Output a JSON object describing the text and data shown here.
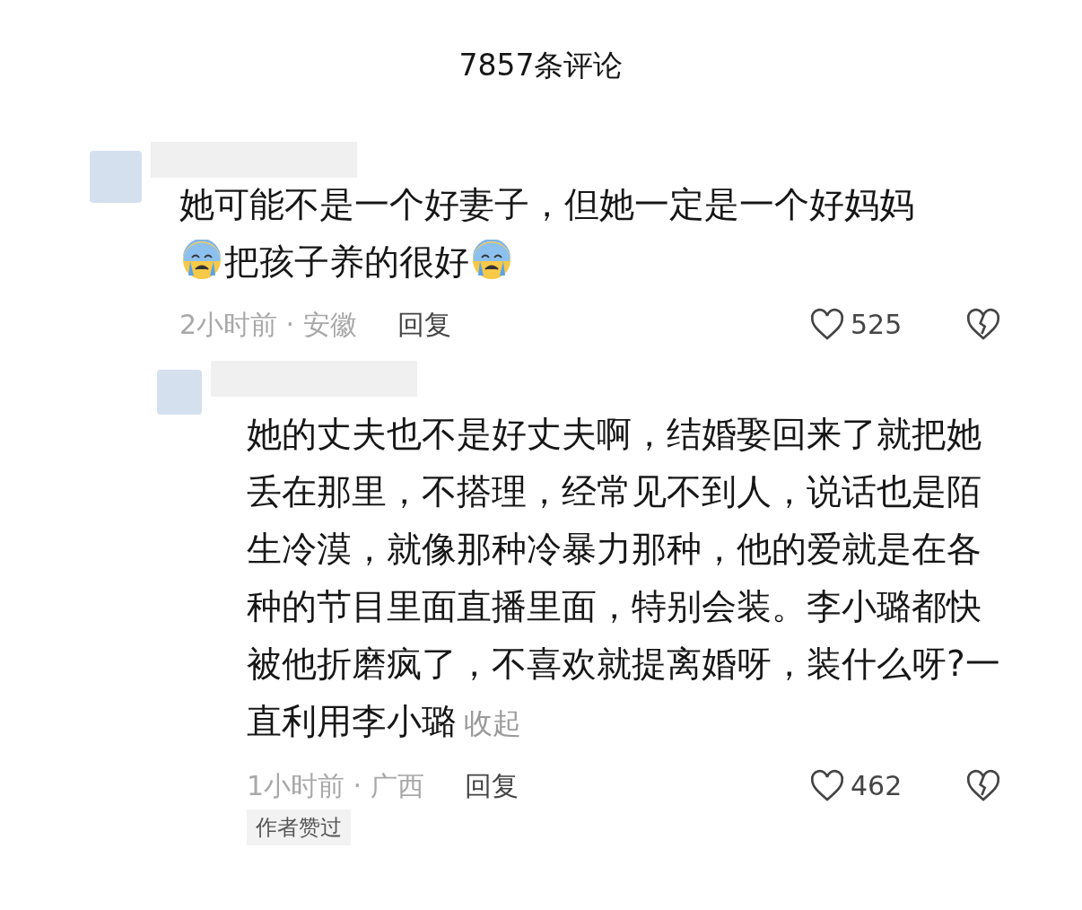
{
  "header": {
    "title": "7857条评论"
  },
  "comments": [
    {
      "body": [
        {
          "kind": "text",
          "text": "她可能不是一个好妻子，但她一定是一个好妈妈"
        },
        {
          "kind": "emoji"
        },
        {
          "kind": "text",
          "text": "把孩子养的很好"
        },
        {
          "kind": "emoji"
        }
      ],
      "meta": "2小时前 · 安徽",
      "reply": "回复",
      "likes": "525",
      "nested": false
    },
    {
      "body": [
        {
          "kind": "text",
          "text": "她的丈夫也不是好丈夫啊，结婚娶回来了就把她丢在那里，不搭理，经常见不到人，说话也是陌生冷漠，就像那种冷暴力那种，他的爱就是在各种的节目里面直播里面，特别会装。李小璐都快被他折磨疯了，不喜欢就提离婚呀，装什么呀?一直利用李小璐"
        }
      ],
      "meta": "1小时前 · 广西",
      "reply": "回复",
      "likes": "462",
      "collapse": "收起",
      "badge": "作者赞过",
      "nested": true
    }
  ]
}
